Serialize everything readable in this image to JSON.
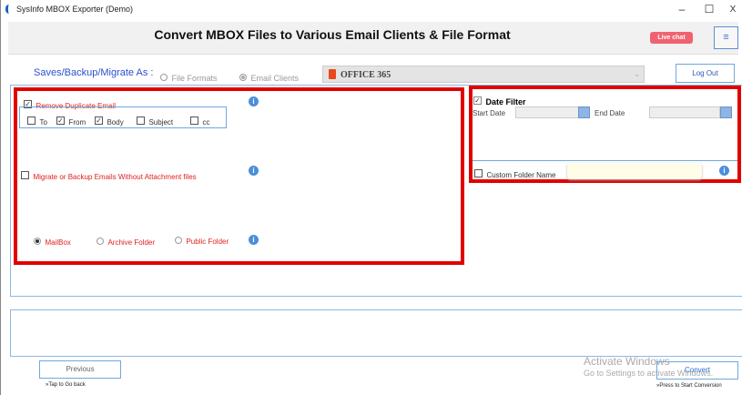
{
  "window": {
    "title": "SysInfo MBOX Exporter (Demo)",
    "minimize": "–",
    "maximize": "☐",
    "close": "X"
  },
  "header": {
    "title": "Convert MBOX Files to Various Email Clients & File Format",
    "live_chat": "Live chat",
    "menu": "≡"
  },
  "save_as": {
    "label": "Saves/Backup/Migrate As :",
    "options": [
      {
        "label": "File Formats",
        "selected": false
      },
      {
        "label": "Email Clients",
        "selected": true
      }
    ],
    "dropdown_value": "OFFICE 365",
    "logout": "Log Out"
  },
  "left_panel": {
    "remove_duplicate": {
      "label": "Remove Duplicate Email",
      "checked": true
    },
    "fields": [
      {
        "label": "To",
        "checked": false
      },
      {
        "label": "From",
        "checked": true
      },
      {
        "label": "Body",
        "checked": true
      },
      {
        "label": "Subject",
        "checked": false
      },
      {
        "label": "cc",
        "checked": false
      }
    ],
    "without_attachment": {
      "label": "Migrate or Backup Emails Without Attachment files",
      "checked": false
    },
    "targets": [
      {
        "label": "MailBox",
        "selected": true
      },
      {
        "label": "Archive Folder",
        "selected": false
      },
      {
        "label": "Public Folder",
        "selected": false
      }
    ],
    "info": "i"
  },
  "right_panel": {
    "date_filter": {
      "label": "Date Filter",
      "checked": true
    },
    "start_date": "Start Date",
    "end_date": "End Date",
    "custom_folder": {
      "label": "Custom Folder Name",
      "checked": false
    }
  },
  "footer": {
    "previous": "Previous",
    "previous_hint": "»Tap to Go back",
    "convert": "Convert",
    "convert_hint": "»Press to Start Conversion"
  },
  "watermark": {
    "line1": "Activate Windows",
    "line2": "Go to Settings to activate Windows."
  }
}
